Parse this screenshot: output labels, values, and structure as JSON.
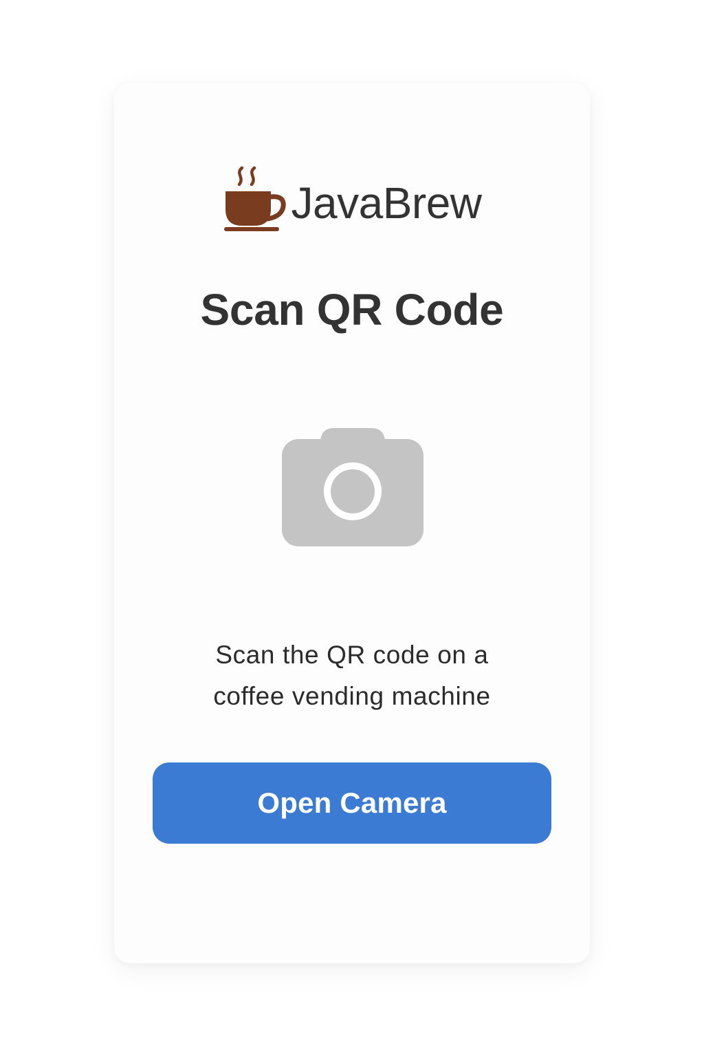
{
  "brand": {
    "name": "JavaBrew",
    "icon": "coffee-cup-icon",
    "icon_color": "#7a3c1e"
  },
  "screen": {
    "title": "Scan QR Code",
    "illustration": "camera-icon",
    "illustration_color": "#c4c4c4",
    "instructions_line1": "Scan the QR code on a",
    "instructions_line2": "coffee vending machine"
  },
  "actions": {
    "open_camera_label": "Open Camera",
    "button_color": "#3c7bd4"
  }
}
